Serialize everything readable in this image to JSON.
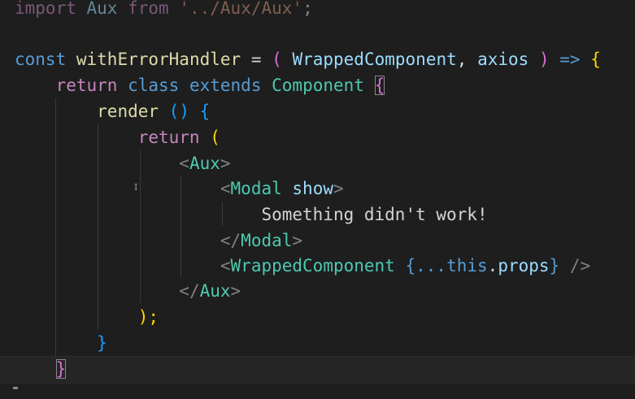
{
  "code": {
    "line1": {
      "import_kw": "import",
      "name": "Aux",
      "from_kw": "from",
      "path": "'../Aux/Aux'",
      "semi": ";"
    },
    "line3": {
      "const_kw": "const",
      "fn_name": "withErrorHandler",
      "eq": "=",
      "open_paren": "(",
      "param1": "WrappedComponent",
      "comma": ",",
      "param2": "axios",
      "close_paren": ")",
      "arrow": "=>",
      "open_brace": "{"
    },
    "line4": {
      "return_kw": "return",
      "class_kw": "class",
      "extends_kw": "extends",
      "base": "Component",
      "open_brace": "{"
    },
    "line5": {
      "method": "render",
      "parens": "()",
      "open_brace": "{"
    },
    "line6": {
      "return_kw": "return",
      "open_paren": "("
    },
    "line7": {
      "lt": "<",
      "tag": "Aux",
      "gt": ">"
    },
    "line8": {
      "lt": "<",
      "tag": "Modal",
      "attr": "show",
      "gt": ">"
    },
    "line9": {
      "text": "Something didn't work!"
    },
    "line10": {
      "lt": "</",
      "tag": "Modal",
      "gt": ">"
    },
    "line11": {
      "lt": "<",
      "tag": "WrappedComponent",
      "open_brace": "{",
      "spread": "...",
      "this_kw": "this",
      "dot": ".",
      "props": "props",
      "close_brace": "}",
      "self_close": "/>"
    },
    "line12": {
      "lt": "</",
      "tag": "Aux",
      "gt": ">"
    },
    "line13": {
      "close": ");"
    },
    "line14": {
      "close": "}"
    },
    "line15": {
      "close": "}"
    }
  },
  "cursor_glyph": "I",
  "colors": {
    "background": "#1e1e1e",
    "keyword_blue": "#569cd6",
    "keyword_purple": "#c586c0",
    "function": "#dcdcaa",
    "variable": "#9cdcfe",
    "class": "#4ec9b0",
    "string": "#ce9178",
    "bracket_gold": "#ffd700",
    "bracket_pink": "#da70d6",
    "bracket_blue": "#179fff"
  }
}
